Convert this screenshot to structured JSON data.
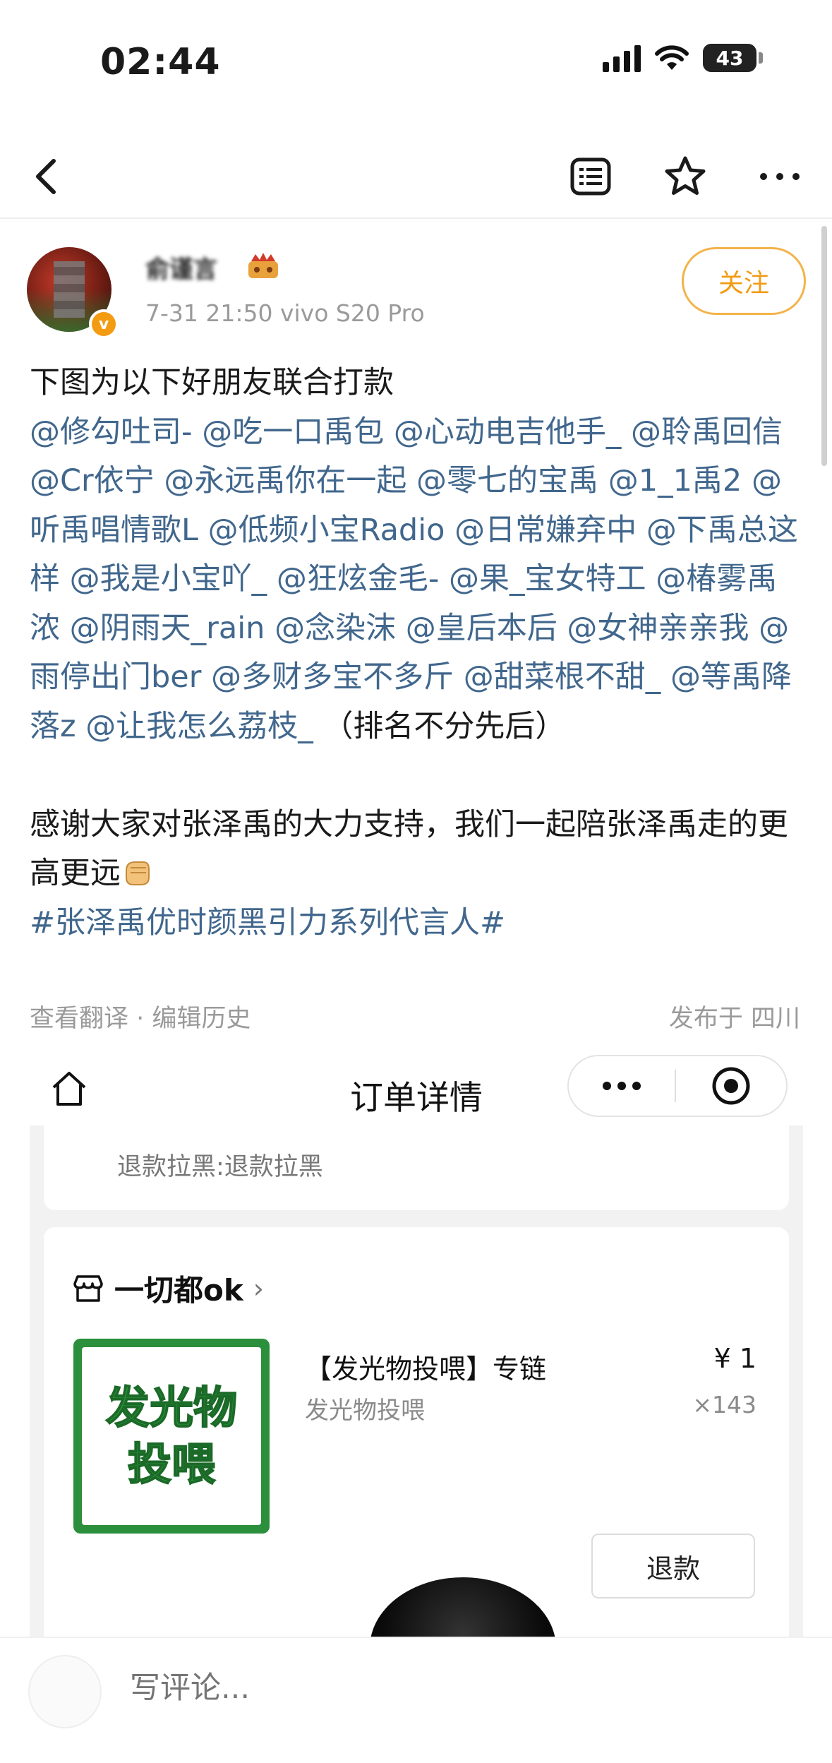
{
  "status_bar": {
    "time": "02:44",
    "battery": "43",
    "battery_level": 0.43
  },
  "nav": {
    "back_icon": "chevron-left-icon",
    "icons": [
      "document-list-icon",
      "star-icon",
      "more-dots-icon"
    ]
  },
  "post": {
    "username": "俞谨言",
    "meta": "7-31 21:50   vivo S20 Pro",
    "follow_label": "关注",
    "intro": "下图为以下好朋友联合打款",
    "mentions": [
      "@修勾吐司-",
      "@吃一口禹包",
      "@心动电吉他手_",
      "@聆禹回信",
      "@Cr依宁",
      "@永远禹你在一起",
      "@零七的宝禹",
      "@1_1禹2",
      "@听禹唱情歌L",
      "@低频小宝Radio",
      "@日常嫌弃中",
      "@下禹总这样",
      "@我是小宝吖_",
      "@狂炫金毛-",
      "@果_宝女特工",
      "@椿雾禹浓",
      "@阴雨天_rain",
      "@念染沫",
      "@皇后本后",
      "@女神亲亲我",
      "@雨停出门ber",
      "@多财多宝不多斤",
      "@甜菜根不甜_",
      "@等禹降落z",
      "@让我怎么荔枝_"
    ],
    "ranking_note": "（排名不分先后）",
    "thanks": "感谢大家对张泽禹的大力支持，我们一起陪张泽禹走的更高更远",
    "topic": "#张泽禹优时颜黑引力系列代言人#",
    "footer_left": "查看翻译 · 编辑历史",
    "footer_right": "发布于 四川"
  },
  "embed": {
    "title": "订单详情",
    "refund_blacklist": "退款拉黑:退款拉黑",
    "shop_name": "一切都ok",
    "product_image_text": [
      "发光物",
      "投喂"
    ],
    "product_title": "【发光物投喂】专链",
    "product_sub": "发光物投喂",
    "price": "¥ 1",
    "qty": "×143",
    "refund_label": "退款"
  },
  "comment": {
    "placeholder": "写评论..."
  },
  "colors": {
    "mention": "#41678d",
    "follow": "#f29b13",
    "product_green": "#2b8f3c"
  }
}
